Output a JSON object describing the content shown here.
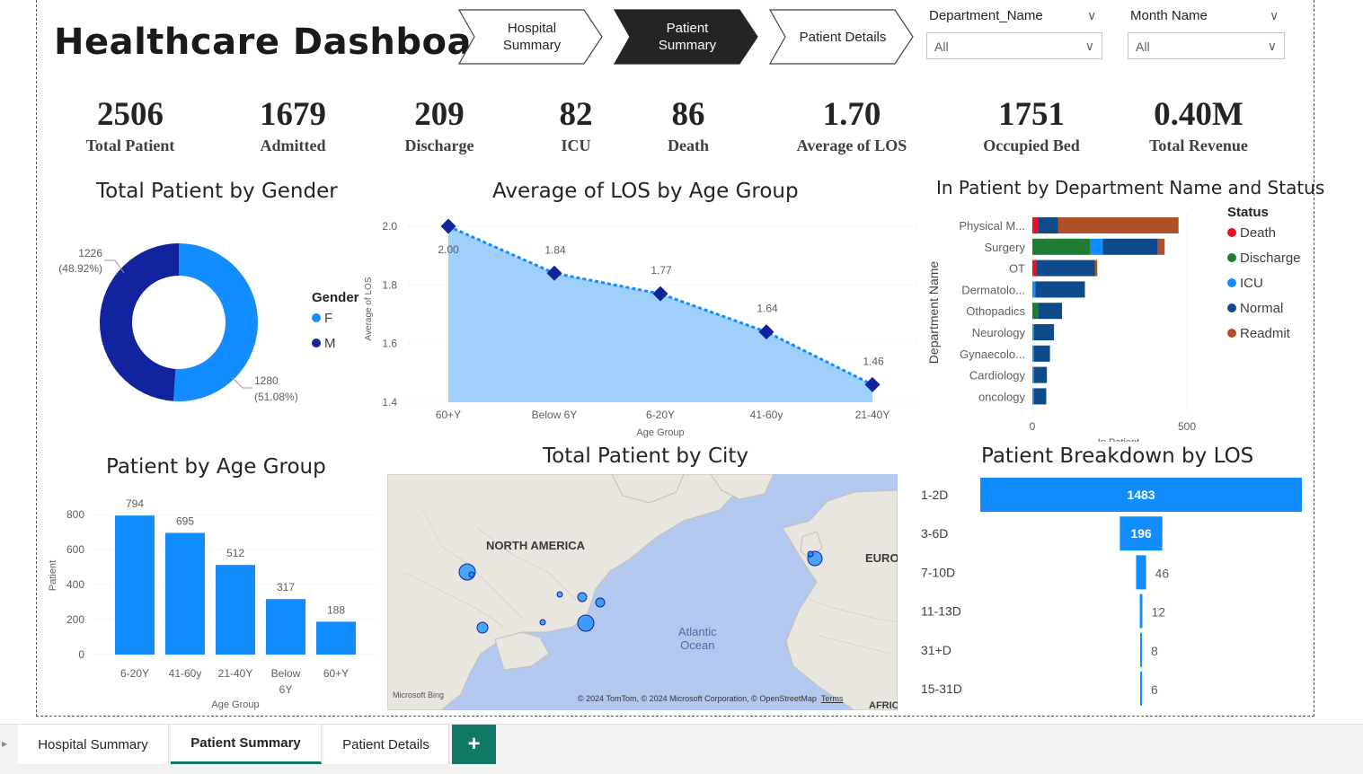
{
  "header": {
    "title": "Healthcare Dashboard"
  },
  "nav": [
    {
      "label": "Hospital Summary",
      "active": false
    },
    {
      "label": "Patient Summary",
      "active": true
    },
    {
      "label": "Patient Details",
      "active": false
    }
  ],
  "slicers": [
    {
      "label": "Department_Name",
      "value": "All"
    },
    {
      "label": "Month Name",
      "value": "All"
    }
  ],
  "kpis": [
    {
      "value": "2506",
      "label": "Total Patient"
    },
    {
      "value": "1679",
      "label": "Admitted"
    },
    {
      "value": "209",
      "label": "Discharge"
    },
    {
      "value": "82",
      "label": "ICU"
    },
    {
      "value": "86",
      "label": "Death"
    },
    {
      "value": "1.70",
      "label": "Average of LOS"
    },
    {
      "value": "1751",
      "label": "Occupied Bed"
    },
    {
      "value": "0.40M",
      "label": "Total Revenue"
    }
  ],
  "colors": {
    "female": "#118dff",
    "male": "#12239e",
    "death": "#e81123",
    "discharge": "#1e7d32",
    "icu": "#118dff",
    "normal": "#0f4a8a",
    "readmit": "#b14f28",
    "accent": "#117865"
  },
  "chart_data": [
    {
      "type": "pie",
      "title": "Total Patient by Gender",
      "legend_title": "Gender",
      "slices": [
        {
          "name": "F",
          "value": 1280,
          "label": "1280",
          "pct_label": "(51.08%)"
        },
        {
          "name": "M",
          "value": 1226,
          "label": "1226",
          "pct_label": "(48.92%)"
        }
      ]
    },
    {
      "type": "area",
      "title": "Average of LOS by Age Group",
      "xlabel": "Age Group",
      "ylabel": "Average of LOS",
      "categories": [
        "60+Y",
        "Below 6Y",
        "6-20Y",
        "41-60y",
        "21-40Y"
      ],
      "values": [
        2.0,
        1.84,
        1.77,
        1.64,
        1.46
      ],
      "data_labels": [
        "2.00",
        "1.84",
        "1.77",
        "1.64",
        "1.46"
      ],
      "ylim": [
        1.4,
        2.0
      ],
      "yticks": [
        "1.4",
        "1.6",
        "1.8",
        "2.0"
      ]
    },
    {
      "type": "bar",
      "orientation": "horizontal",
      "stacked": true,
      "title": "In Patient by Department Name and Status",
      "ylabel": "Department Name",
      "xlabel": "In Patient",
      "legend_title": "Status",
      "categories": [
        "Physical M...",
        "Surgery",
        "OT",
        "Dermatolo...",
        "Othopadics",
        "Neurology",
        "Gynaecolo...",
        "Cardiology",
        "oncology"
      ],
      "series": [
        {
          "name": "Death",
          "values": [
            18,
            0,
            12,
            0,
            0,
            0,
            0,
            0,
            0
          ]
        },
        {
          "name": "Discharge",
          "values": [
            0,
            188,
            0,
            0,
            18,
            0,
            0,
            0,
            0
          ]
        },
        {
          "name": "ICU",
          "values": [
            0,
            40,
            0,
            10,
            0,
            5,
            5,
            5,
            5
          ]
        },
        {
          "name": "Normal",
          "values": [
            65,
            178,
            190,
            160,
            78,
            65,
            52,
            42,
            40
          ]
        },
        {
          "name": "Readmit",
          "values": [
            390,
            22,
            8,
            0,
            0,
            0,
            0,
            0,
            0
          ]
        }
      ],
      "xlim": [
        0,
        500
      ],
      "xticks": [
        "0",
        "500"
      ]
    },
    {
      "type": "bar",
      "title": "Patient by Age Group",
      "xlabel": "Age Group",
      "ylabel": "Patient",
      "categories": [
        "6-20Y",
        "41-60y",
        "21-40Y",
        "Below 6Y",
        "60+Y"
      ],
      "values": [
        794,
        695,
        512,
        317,
        188
      ],
      "data_labels": [
        "794",
        "695",
        "512",
        "317",
        "188"
      ],
      "ylim": [
        0,
        800
      ],
      "yticks": [
        "0",
        "200",
        "400",
        "600",
        "800"
      ]
    },
    {
      "type": "bar",
      "orientation": "horizontal",
      "title": "Patient Breakdown by LOS",
      "categories": [
        "1-2D",
        "3-6D",
        "7-10D",
        "11-13D",
        "31+D",
        "15-31D"
      ],
      "values": [
        1483,
        196,
        46,
        12,
        8,
        6
      ],
      "data_labels": [
        "1483",
        "196",
        "46",
        "12",
        "8",
        "6"
      ]
    }
  ],
  "map": {
    "title": "Total Patient by City",
    "labels": {
      "na": "NORTH AMERICA",
      "europe": "EUROI",
      "ocean1": "Atlantic",
      "ocean2": "Ocean",
      "africa": "AFRIC"
    },
    "attribution": "© 2024 TomTom, © 2024 Microsoft Corporation, © OpenStreetMap",
    "terms": "Terms",
    "logo": "Microsoft Bing"
  },
  "tabs": [
    "Hospital Summary",
    "Patient Summary",
    "Patient Details"
  ],
  "tab_add": "+"
}
